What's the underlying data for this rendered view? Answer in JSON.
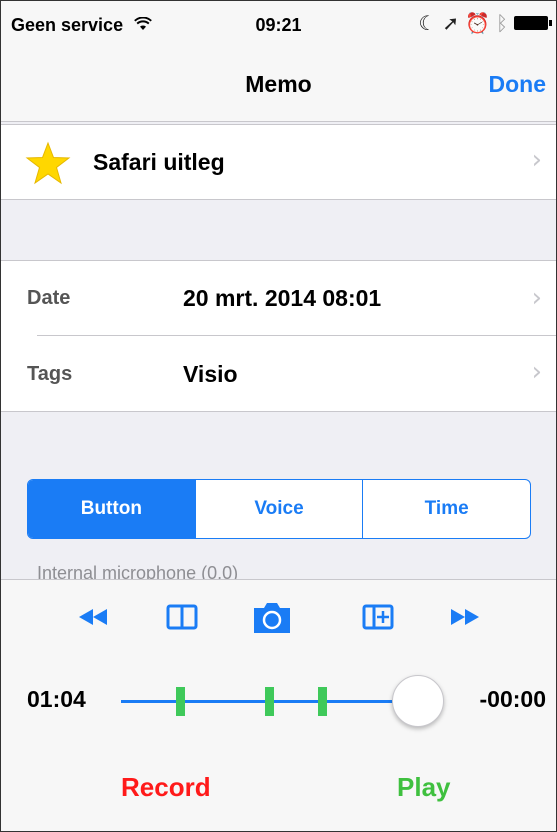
{
  "status_bar": {
    "carrier": "Geen service",
    "time": "09:21",
    "icons": [
      "wifi-icon",
      "moon-icon",
      "location-arrow-icon",
      "alarm-icon",
      "bluetooth-icon",
      "battery-icon"
    ]
  },
  "nav": {
    "title": "Memo",
    "done_label": "Done"
  },
  "memo": {
    "title": "Safari uitleg",
    "starred": true
  },
  "details": {
    "date_label": "Date",
    "date_value": "20 mrt. 2014 08:01",
    "tags_label": "Tags",
    "tags_value": "Visio"
  },
  "segments": {
    "items": [
      "Button",
      "Voice",
      "Time"
    ],
    "selected": "Button"
  },
  "input_source": "Internal microphone (0.0)",
  "player": {
    "elapsed": "01:04",
    "remaining": "-00:00",
    "position": 1.0,
    "bookmark_positions": [
      0.2,
      0.5,
      0.68
    ],
    "record_label": "Record",
    "play_label": "Play",
    "toolbar_icons": [
      "rewind-icon",
      "book-icon",
      "camera-icon",
      "add-bookmark-icon",
      "fast-forward-icon"
    ]
  },
  "colors": {
    "accent": "#1a7cf5",
    "record": "#ff1a1a",
    "play": "#3fc03f",
    "bookmark": "#3fc95a",
    "star": "#ffd700"
  }
}
